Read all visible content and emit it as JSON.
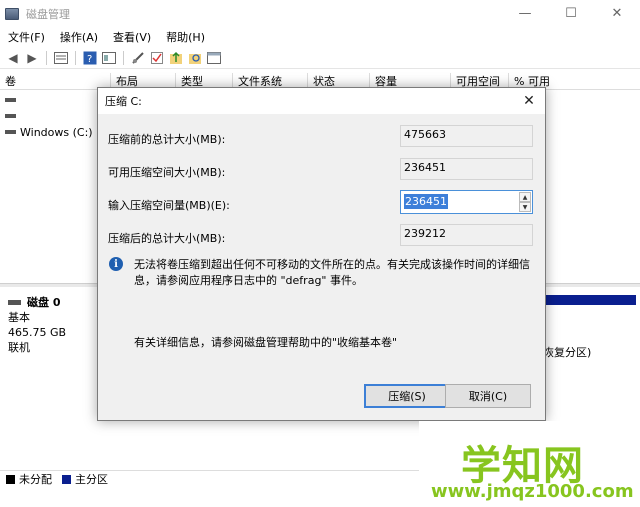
{
  "window": {
    "title": "磁盘管理",
    "controls": {
      "minimize": "—",
      "maximize": "☐",
      "close": "✕"
    }
  },
  "menu": [
    "文件(F)",
    "操作(A)",
    "查看(V)",
    "帮助(H)"
  ],
  "columns": [
    "卷",
    "布局",
    "类型",
    "文件系统",
    "状态",
    "容量",
    "可用空间",
    "% 可用"
  ],
  "volumes": [
    "",
    "",
    "Windows (C:)"
  ],
  "disk": {
    "name": "磁盘 0",
    "type": "基本",
    "size": "465.75 GB",
    "status": "联机",
    "partition_fragment": "恢复分区)"
  },
  "legend": [
    {
      "label": "未分配",
      "color": "#000000"
    },
    {
      "label": "主分区",
      "color": "#0a1f8f"
    }
  ],
  "dialog": {
    "title": "压缩 C:",
    "close": "✕",
    "fields": [
      {
        "label": "压缩前的总计大小(MB):",
        "value": "475663"
      },
      {
        "label": "可用压缩空间大小(MB):",
        "value": "236451"
      },
      {
        "label": "输入压缩空间量(MB)(E):",
        "value": "236451"
      },
      {
        "label": "压缩后的总计大小(MB):",
        "value": "239212"
      }
    ],
    "info_icon": "i",
    "info": "无法将卷压缩到超出任何不可移动的文件所在的点。有关完成该操作时间的详细信息，请参阅应用程序日志中的 \"defrag\" 事件。",
    "help": "有关详细信息，请参阅磁盘管理帮助中的\"收缩基本卷\"",
    "ok_button": "压缩(S)",
    "cancel_button": "取消(C)"
  },
  "watermark": {
    "main": "学知网",
    "url": "www.jmqz1000.com"
  }
}
